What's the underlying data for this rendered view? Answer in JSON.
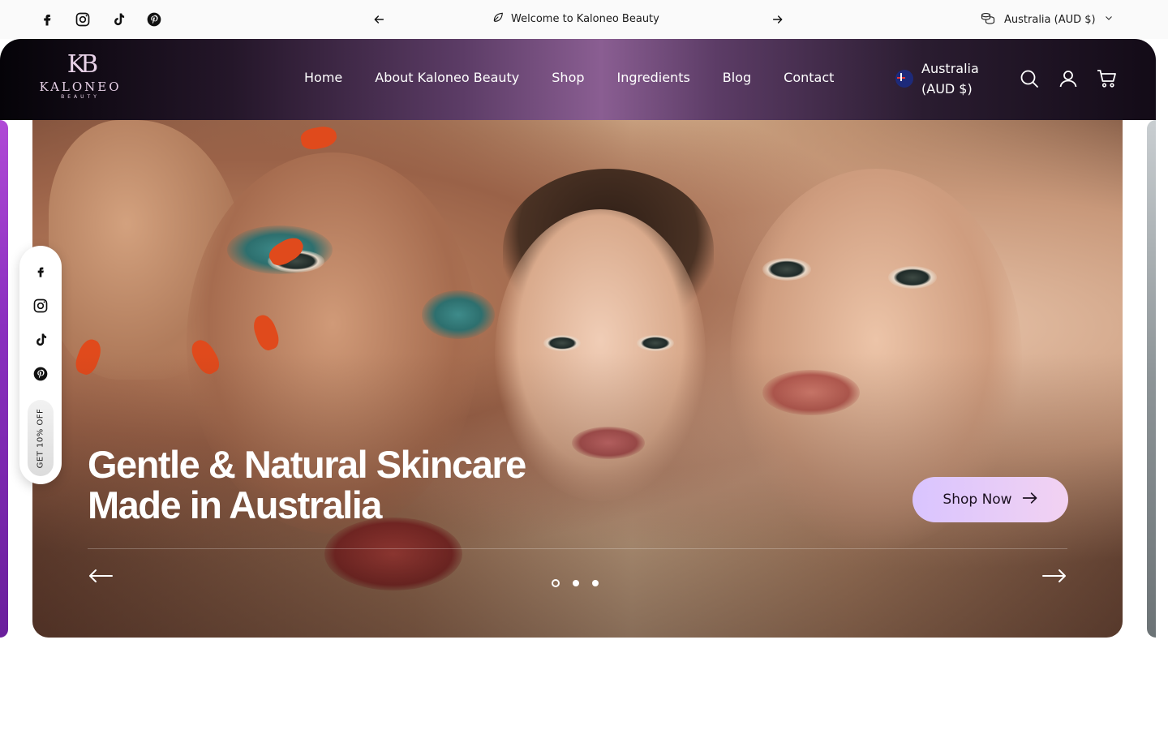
{
  "topbar": {
    "social_icons": [
      "facebook-icon",
      "instagram-icon",
      "tiktok-icon",
      "pinterest-icon"
    ],
    "announcement": "Welcome to Kaloneo Beauty",
    "currency": "Australia (AUD $)"
  },
  "header": {
    "logo": {
      "monogram": "KB",
      "brand": "KALONEO",
      "sub": "BEAUTY"
    },
    "nav": [
      {
        "label": "Home"
      },
      {
        "label": "About Kaloneo Beauty"
      },
      {
        "label": "Shop"
      },
      {
        "label": "Ingredients"
      },
      {
        "label": "Blog"
      },
      {
        "label": "Contact"
      }
    ],
    "currency": "Australia (AUD $)",
    "icons": [
      "search-icon",
      "account-icon",
      "cart-icon"
    ]
  },
  "hero": {
    "headline": "Gentle & Natural Skincare Made in Australia",
    "cta_label": "Shop Now",
    "slide_count": 3,
    "active_slide": 1
  },
  "floating_rail": {
    "icons": [
      "facebook-icon",
      "instagram-icon",
      "tiktok-icon",
      "pinterest-icon"
    ],
    "promo_label": "GET 10% OFF"
  },
  "colors": {
    "header_accent": "#8a5e92",
    "cta_gradient_start": "#d9c4ff",
    "cta_gradient_end": "#f2d2f2"
  }
}
